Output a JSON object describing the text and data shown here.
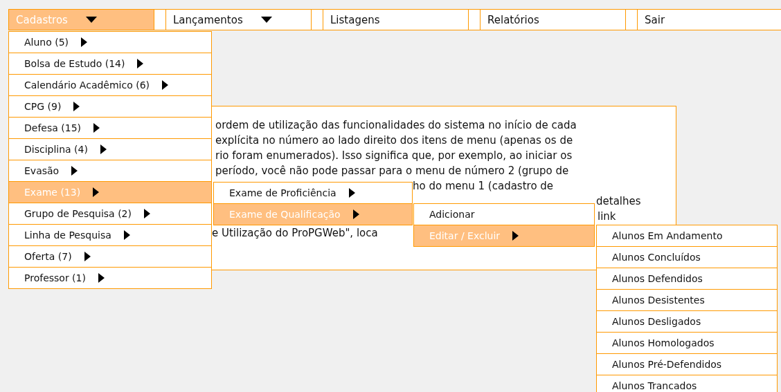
{
  "menu_bar": [
    {
      "label": "Cadastros",
      "selected": true,
      "has_submenu": true
    },
    {
      "label": "Lançamentos",
      "selected": false,
      "has_submenu": true
    },
    {
      "label": "Listagens",
      "selected": false,
      "has_submenu": false
    },
    {
      "label": "Relatórios",
      "selected": false,
      "has_submenu": false
    },
    {
      "label": "Sair",
      "selected": false,
      "has_submenu": false
    }
  ],
  "content_panel": {
    "lines": [
      "ordem de utilização das funcionalidades do sistema no início de cada",
      "explícita no número ao lado direito dos itens de menu (apenas os de",
      "rio foram enumerados). Isso significa que, por exemplo, ao iniciar os",
      "período, você não pode passar para o menu de número 2 (grupo de",
      "ho do menu 1 (cadastro de",
      "detalhes",
      "link",
      "e Utilização do ProPGWeb\", loca"
    ]
  },
  "menus": [
    {
      "items": [
        {
          "label": "Aluno (5)",
          "selected": false,
          "has_submenu": true
        },
        {
          "label": "Bolsa de Estudo (14)",
          "selected": false,
          "has_submenu": true
        },
        {
          "label": "Calendário Acadêmico (6)",
          "selected": false,
          "has_submenu": true
        },
        {
          "label": "CPG (9)",
          "selected": false,
          "has_submenu": true
        },
        {
          "label": "Defesa (15)",
          "selected": false,
          "has_submenu": true
        },
        {
          "label": "Disciplina (4)",
          "selected": false,
          "has_submenu": true
        },
        {
          "label": "Evasão",
          "selected": false,
          "has_submenu": true
        },
        {
          "label": "Exame (13)",
          "selected": true,
          "has_submenu": true
        },
        {
          "label": "Grupo de Pesquisa (2)",
          "selected": false,
          "has_submenu": true
        },
        {
          "label": "Linha de Pesquisa",
          "selected": false,
          "has_submenu": true
        },
        {
          "label": "Oferta (7)",
          "selected": false,
          "has_submenu": true
        },
        {
          "label": "Professor (1)",
          "selected": false,
          "has_submenu": true
        }
      ]
    },
    {
      "items": [
        {
          "label": "Exame de Proficiência",
          "selected": false,
          "has_submenu": true
        },
        {
          "label": "Exame de Qualificação",
          "selected": true,
          "has_submenu": true
        }
      ]
    },
    {
      "items": [
        {
          "label": "Adicionar",
          "selected": false,
          "has_submenu": false
        },
        {
          "label": "Editar / Excluir",
          "selected": true,
          "has_submenu": true
        }
      ]
    },
    {
      "items": [
        {
          "label": "Alunos Em Andamento",
          "selected": false,
          "has_submenu": false
        },
        {
          "label": "Alunos Concluídos",
          "selected": false,
          "has_submenu": false
        },
        {
          "label": "Alunos Defendidos",
          "selected": false,
          "has_submenu": false
        },
        {
          "label": "Alunos Desistentes",
          "selected": false,
          "has_submenu": false
        },
        {
          "label": "Alunos Desligados",
          "selected": false,
          "has_submenu": false
        },
        {
          "label": "Alunos Homologados",
          "selected": false,
          "has_submenu": false
        },
        {
          "label": "Alunos Pré-Defendidos",
          "selected": false,
          "has_submenu": false
        },
        {
          "label": "Alunos Trancados",
          "selected": false,
          "has_submenu": false
        }
      ]
    }
  ]
}
